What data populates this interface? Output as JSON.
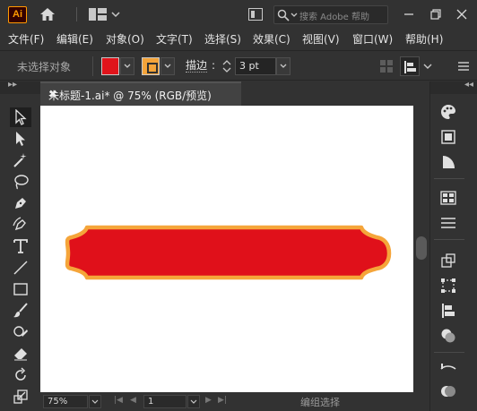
{
  "app": {
    "logo_text": "Ai",
    "search_placeholder": "搜索 Adobe 帮助"
  },
  "menu": {
    "items": [
      "文件(F)",
      "编辑(E)",
      "对象(O)",
      "文字(T)",
      "选择(S)",
      "效果(C)",
      "视图(V)",
      "窗口(W)",
      "帮助(H)"
    ]
  },
  "control": {
    "selection_status": "未选择对象",
    "fill_color": "#e0141b",
    "stroke_color": "#f4a43a",
    "stroke_label": "描边",
    "stroke_weight": "3 pt"
  },
  "document": {
    "tab_title": "未标题-1.ai* @ 75% (RGB/预览)",
    "close_glyph": "✖"
  },
  "canvas": {
    "shape_fill": "#e0101a",
    "shape_stroke": "#f5a53a"
  },
  "status": {
    "zoom": "75%",
    "page": "1",
    "current_tool": "编组选择"
  }
}
